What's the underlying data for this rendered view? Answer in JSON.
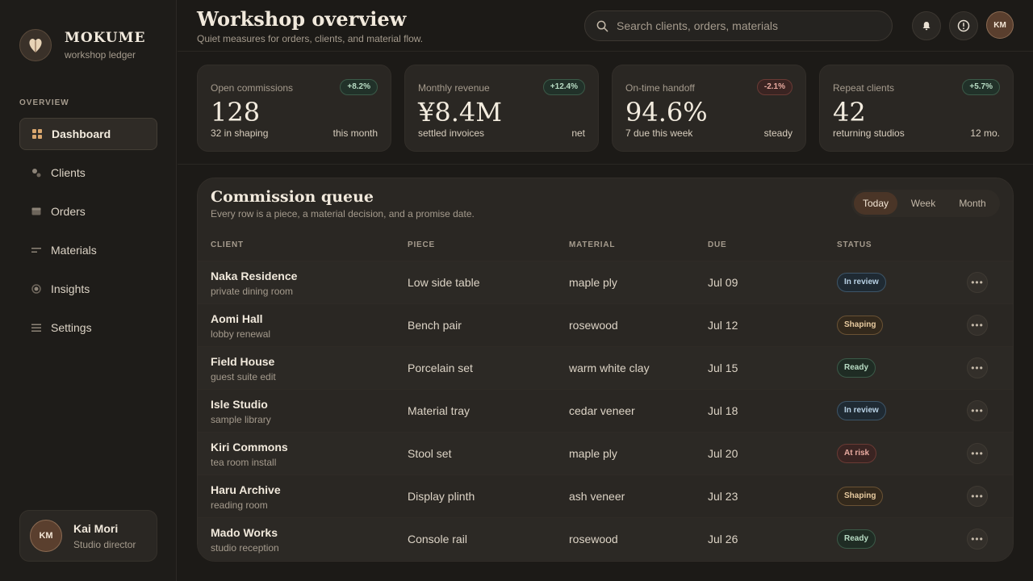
{
  "brand": {
    "name": "MOKUME",
    "subtitle": "workshop ledger"
  },
  "sidebar": {
    "section_label": "OVERVIEW",
    "items": [
      {
        "label": "Dashboard",
        "icon": "grid-icon",
        "active": true
      },
      {
        "label": "Clients",
        "icon": "people-icon"
      },
      {
        "label": "Orders",
        "icon": "box-icon"
      },
      {
        "label": "Materials",
        "icon": "lines-icon"
      },
      {
        "label": "Insights",
        "icon": "dot-icon"
      },
      {
        "label": "Settings",
        "icon": "menu-icon"
      }
    ],
    "user": {
      "initials": "KM",
      "name": "Kai Mori",
      "role": "Studio director"
    }
  },
  "header": {
    "title": "Workshop overview",
    "subtitle": "Quiet measures for orders, clients, and material flow.",
    "search_placeholder": "Search clients, orders, materials",
    "avatar_initials": "KM"
  },
  "stats": [
    {
      "label": "Open commissions",
      "badge": "+8.2%",
      "trend": "up",
      "value": "128",
      "note": "32 in shaping",
      "right": "this month"
    },
    {
      "label": "Monthly revenue",
      "badge": "+12.4%",
      "trend": "up",
      "value": "¥8.4M",
      "note": "settled invoices",
      "right": "net"
    },
    {
      "label": "On-time handoff",
      "badge": "-2.1%",
      "trend": "down",
      "value": "94.6%",
      "note": "7 due this week",
      "right": "steady"
    },
    {
      "label": "Repeat clients",
      "badge": "+5.7%",
      "trend": "up",
      "value": "42",
      "note": "returning studios",
      "right": "12 mo."
    }
  ],
  "queue": {
    "title": "Commission queue",
    "subtitle": "Every row is a piece, a material decision, and a promise date.",
    "tabs": [
      "Today",
      "Week",
      "Month"
    ],
    "active_tab": "Today",
    "columns": [
      "CLIENT",
      "PIECE",
      "MATERIAL",
      "DUE",
      "STATUS"
    ],
    "rows": [
      {
        "client": "Naka Residence",
        "client_sub": "private dining room",
        "piece": "Low side table",
        "material": "maple ply",
        "due": "Jul 09",
        "status": "In review"
      },
      {
        "client": "Aomi Hall",
        "client_sub": "lobby renewal",
        "piece": "Bench pair",
        "material": "rosewood",
        "due": "Jul 12",
        "status": "Shaping"
      },
      {
        "client": "Field House",
        "client_sub": "guest suite edit",
        "piece": "Porcelain set",
        "material": "warm white clay",
        "due": "Jul 15",
        "status": "Ready"
      },
      {
        "client": "Isle Studio",
        "client_sub": "sample library",
        "piece": "Material tray",
        "material": "cedar veneer",
        "due": "Jul 18",
        "status": "In review"
      },
      {
        "client": "Kiri Commons",
        "client_sub": "tea room install",
        "piece": "Stool set",
        "material": "maple ply",
        "due": "Jul 20",
        "status": "At risk"
      },
      {
        "client": "Haru Archive",
        "client_sub": "reading room",
        "piece": "Display plinth",
        "material": "ash veneer",
        "due": "Jul 23",
        "status": "Shaping"
      },
      {
        "client": "Mado Works",
        "client_sub": "studio reception",
        "piece": "Console rail",
        "material": "rosewood",
        "due": "Jul 26",
        "status": "Ready"
      }
    ]
  },
  "colors": {
    "accent": "#4a3527",
    "background": "#1c1a17",
    "card": "#2a2723"
  }
}
